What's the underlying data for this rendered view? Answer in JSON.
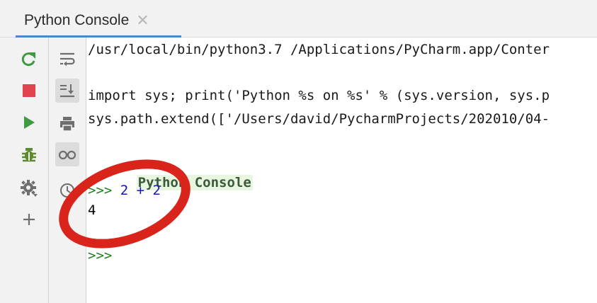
{
  "window": {
    "tab_label": "Python Console",
    "tab_close_icon": "close-icon"
  },
  "toolbar_primary": [
    {
      "name": "rerun-icon",
      "color": "#3d9a41"
    },
    {
      "name": "stop-icon",
      "color": "#e0434d"
    },
    {
      "name": "run-icon",
      "color": "#3d9a41"
    },
    {
      "name": "debug-icon",
      "color": "#5d8a2e"
    },
    {
      "name": "settings-icon",
      "color": "#6e6e6e"
    },
    {
      "name": "add-icon",
      "color": "#6e6e6e"
    }
  ],
  "toolbar_secondary": [
    {
      "name": "soft-wrap-icon"
    },
    {
      "name": "scroll-to-end-icon",
      "active": true
    },
    {
      "name": "print-icon"
    },
    {
      "name": "show-variables-icon",
      "active": true
    },
    {
      "name": "history-icon"
    }
  ],
  "console": {
    "line1": "/usr/local/bin/python3.7 /Applications/PyCharm.app/Conter",
    "line2": "import sys; print('Python %s on %s' % (sys.version, sys.p",
    "line3": "sys.path.extend(['/Users/david/PycharmProjects/202010/04-",
    "banner": "Python Console",
    "prompt1": ">>>",
    "input1": " 2 + 2",
    "output1": "4",
    "prompt2": ">>>"
  },
  "annotation": {
    "circle_color": "#d9241c"
  }
}
